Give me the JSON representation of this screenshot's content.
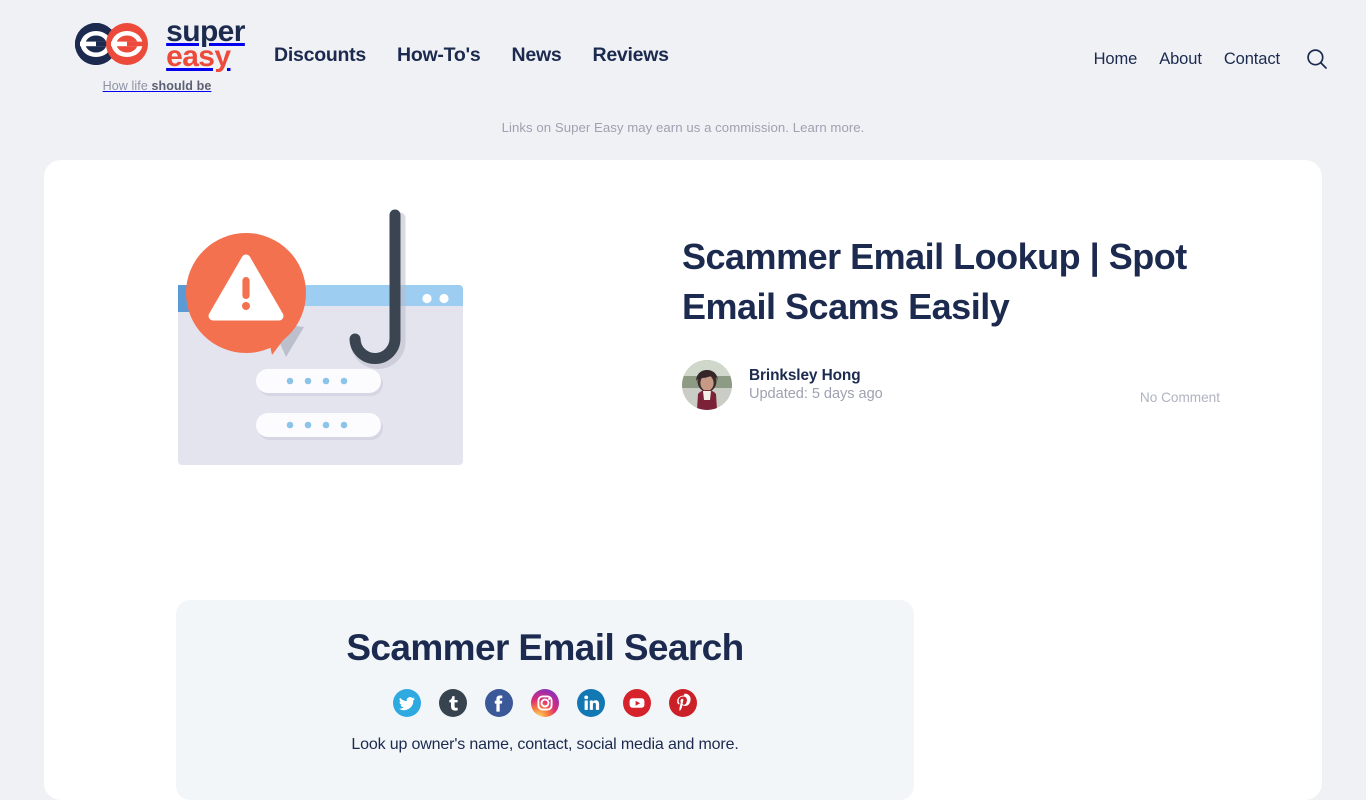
{
  "brand": {
    "name_line1": "super",
    "name_line2": "easy",
    "tagline_prefix": "How life ",
    "tagline_bold": "should be",
    "logo_icon": "super-easy-double-e-logo",
    "navy": "#1b2a4e",
    "red": "#ec4a3b"
  },
  "nav": {
    "main": [
      {
        "label": "Discounts"
      },
      {
        "label": "How-To's"
      },
      {
        "label": "News"
      },
      {
        "label": "Reviews"
      }
    ],
    "right": [
      {
        "label": "Home"
      },
      {
        "label": "About"
      },
      {
        "label": "Contact"
      }
    ],
    "search_icon": "search-icon"
  },
  "disclosure": {
    "text": "Links on Super Easy may earn us a commission.",
    "link_label": "Learn more."
  },
  "article": {
    "title": "Scammer Email Lookup | Spot Email Scams Easily",
    "author": "Brinksley Hong",
    "updated": "Updated: 5 days ago",
    "comments": "No Comment",
    "hero_illustration": "phishing-email-warning-illustration"
  },
  "search_panel": {
    "title": "Scammer Email Search",
    "subtitle": "Look up owner's name, contact, social media and more.",
    "socials": [
      {
        "name": "twitter",
        "color": "#2eaae1"
      },
      {
        "name": "tumblr",
        "color": "#37444f"
      },
      {
        "name": "facebook",
        "color": "#3b5998"
      },
      {
        "name": "instagram",
        "color": "#c13584"
      },
      {
        "name": "linkedin",
        "color": "#1178b3"
      },
      {
        "name": "youtube",
        "color": "#d6232b"
      },
      {
        "name": "pinterest",
        "color": "#cb2027"
      }
    ]
  },
  "theme": {
    "page_bg": "#f0f1f5",
    "card_bg": "#ffffff",
    "panel_bg": "#f2f6f9",
    "text_navy": "#1b2a4e",
    "muted": "#9ea2b0"
  }
}
